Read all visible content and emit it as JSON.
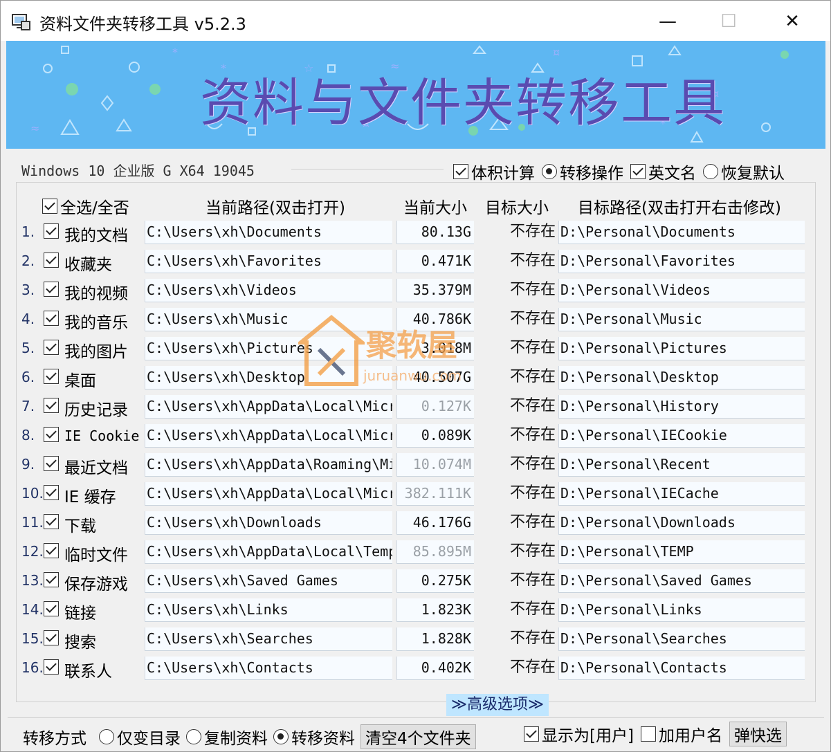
{
  "window": {
    "title": "资料文件夹转移工具 v5.2.3",
    "minimize": "—",
    "maximize": "☐",
    "close": "✕"
  },
  "banner": {
    "title": "资料与文件夹转移工具"
  },
  "system": {
    "os_info": "Windows 10 企业版 G    X64 19045"
  },
  "options": {
    "size_calc": "体积计算",
    "transfer_op": "转移操作",
    "english_name": "英文名",
    "restore_default": "恢复默认"
  },
  "header": {
    "select_all": "全选/全否",
    "current_path": "当前路径(双击打开)",
    "current_size": "当前大小",
    "target_size": "目标大小",
    "target_path": "目标路径(双击打开右击修改)"
  },
  "rows": [
    {
      "num": "1.",
      "name": "我的文档",
      "path": "C:\\Users\\xh\\Documents",
      "size": "80.13G",
      "dim": false,
      "tsize": "不存在",
      "tpath": "D:\\Personal\\Documents"
    },
    {
      "num": "2.",
      "name": "收藏夹",
      "path": "C:\\Users\\xh\\Favorites",
      "size": "0.471K",
      "dim": false,
      "tsize": "不存在",
      "tpath": "D:\\Personal\\Favorites"
    },
    {
      "num": "3.",
      "name": "我的视频",
      "path": "C:\\Users\\xh\\Videos",
      "size": "35.379M",
      "dim": false,
      "tsize": "不存在",
      "tpath": "D:\\Personal\\Videos"
    },
    {
      "num": "4.",
      "name": "我的音乐",
      "path": "C:\\Users\\xh\\Music",
      "size": "40.786K",
      "dim": false,
      "tsize": "不存在",
      "tpath": "D:\\Personal\\Music"
    },
    {
      "num": "5.",
      "name": "我的图片",
      "path": "C:\\Users\\xh\\Pictures",
      "size": "3.018M",
      "dim": false,
      "tsize": "不存在",
      "tpath": "D:\\Personal\\Pictures"
    },
    {
      "num": "6.",
      "name": "桌面",
      "path": "C:\\Users\\xh\\Desktop",
      "size": "40.507G",
      "dim": false,
      "tsize": "不存在",
      "tpath": "D:\\Personal\\Desktop"
    },
    {
      "num": "7.",
      "name": "历史记录",
      "path": "C:\\Users\\xh\\AppData\\Local\\Micr",
      "size": "0.127K",
      "dim": true,
      "tsize": "不存在",
      "tpath": "D:\\Personal\\History"
    },
    {
      "num": "8.",
      "name": "IE Cookie",
      "latin": true,
      "path": "C:\\Users\\xh\\AppData\\Local\\Micr",
      "size": "0.089K",
      "dim": false,
      "tsize": "不存在",
      "tpath": "D:\\Personal\\IECookie"
    },
    {
      "num": "9.",
      "name": "最近文档",
      "path": "C:\\Users\\xh\\AppData\\Roaming\\Mi",
      "size": "10.074M",
      "dim": true,
      "tsize": "不存在",
      "tpath": "D:\\Personal\\Recent"
    },
    {
      "num": "10.",
      "name": "IE 缓存",
      "path": "C:\\Users\\xh\\AppData\\Local\\Micr",
      "size": "382.111K",
      "dim": true,
      "tsize": "不存在",
      "tpath": "D:\\Personal\\IECache"
    },
    {
      "num": "11.",
      "name": "下载",
      "path": "C:\\Users\\xh\\Downloads",
      "size": "46.176G",
      "dim": false,
      "tsize": "不存在",
      "tpath": "D:\\Personal\\Downloads"
    },
    {
      "num": "12.",
      "name": "临时文件",
      "path": "C:\\Users\\xh\\AppData\\Local\\Temp",
      "size": "85.895M",
      "dim": true,
      "tsize": "不存在",
      "tpath": "D:\\Personal\\TEMP"
    },
    {
      "num": "13.",
      "name": "保存游戏",
      "path": "C:\\Users\\xh\\Saved Games",
      "size": "0.275K",
      "dim": false,
      "tsize": "不存在",
      "tpath": "D:\\Personal\\Saved Games"
    },
    {
      "num": "14.",
      "name": "链接",
      "path": "C:\\Users\\xh\\Links",
      "size": "1.823K",
      "dim": false,
      "tsize": "不存在",
      "tpath": "D:\\Personal\\Links"
    },
    {
      "num": "15.",
      "name": "搜索",
      "path": "C:\\Users\\xh\\Searches",
      "size": "1.828K",
      "dim": false,
      "tsize": "不存在",
      "tpath": "D:\\Personal\\Searches"
    },
    {
      "num": "16.",
      "name": "联系人",
      "path": "C:\\Users\\xh\\Contacts",
      "size": "0.402K",
      "dim": false,
      "tsize": "不存在",
      "tpath": "D:\\Personal\\Contacts"
    }
  ],
  "advanced": {
    "label": "≫高级选项≫"
  },
  "bottom": {
    "method_label": "转移方式",
    "only_dir": "仅变目录",
    "copy_data": "复制资料",
    "move_data": "转移资料",
    "clear_button": "清空4个文件夹",
    "show_as_user": "显示为[用户]",
    "add_username": "加用户名",
    "quick_select": "弹快选"
  },
  "watermark": {
    "text": "聚软屋",
    "sub": "juruanwu.com"
  },
  "colors": {
    "banner": "#5eb7f2",
    "banner_title": "#5a4bb0",
    "field_bg": "#f7fbff",
    "advanced_bg": "#bfe6ff"
  }
}
